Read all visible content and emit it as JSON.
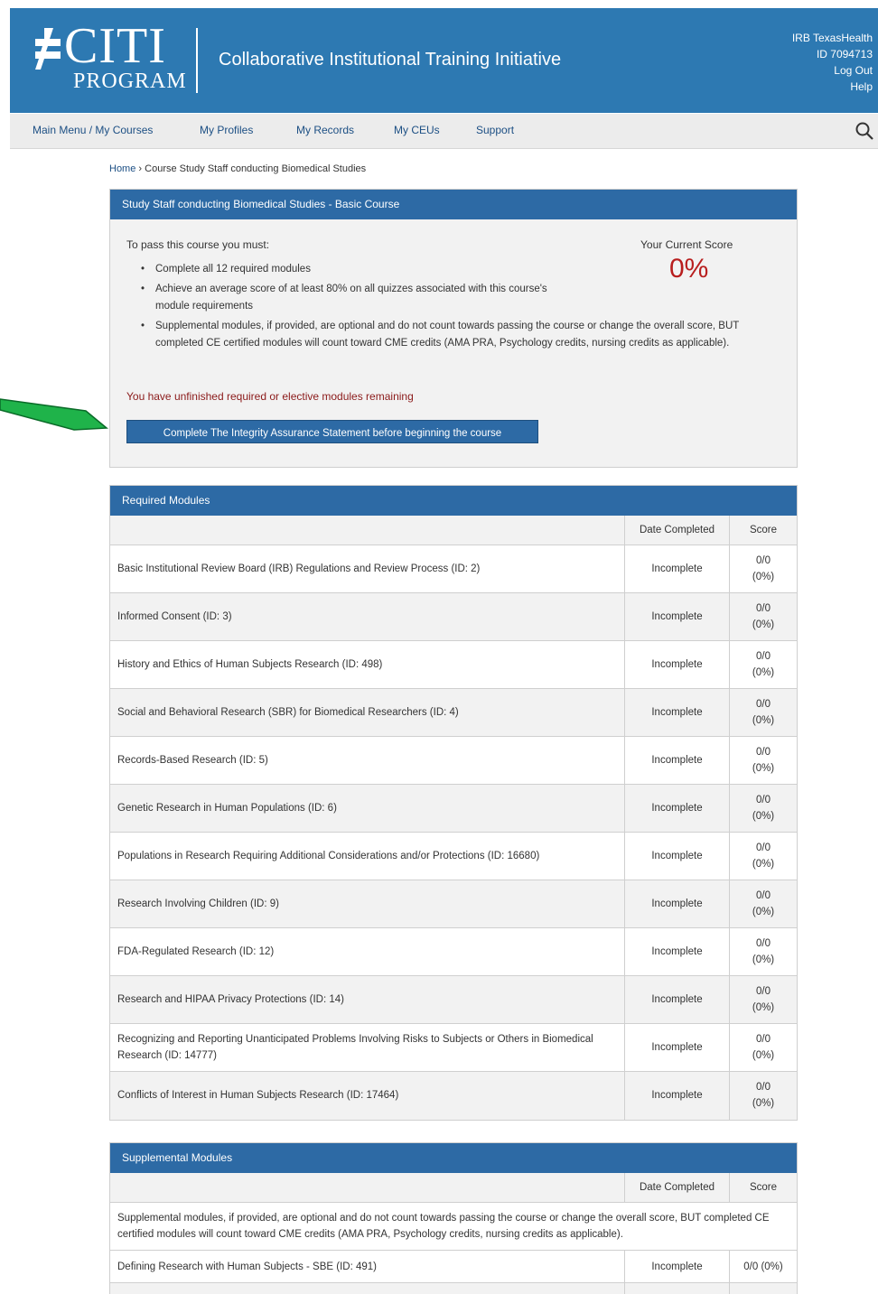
{
  "header": {
    "logo_main": "CITI",
    "logo_sub": "PROGRAM",
    "title": "Collaborative Institutional Training Initiative",
    "user_org": "IRB TexasHealth",
    "user_id": "ID 7094713",
    "logout": "Log Out",
    "help": "Help"
  },
  "nav": {
    "items": [
      "Main Menu / My Courses",
      "My Profiles",
      "My Records",
      "My CEUs",
      "Support"
    ]
  },
  "breadcrumb": {
    "home": "Home",
    "separator": "›",
    "current": "Course Study Staff conducting Biomedical Studies"
  },
  "course": {
    "title": "Study Staff conducting Biomedical Studies - Basic Course",
    "intro": "To pass this course you must:",
    "requirements": [
      "Complete all 12 required modules",
      "Achieve an average score of at least 80% on all quizzes associated with this course's module requirements",
      "Supplemental modules, if provided, are optional and do not count towards passing the course or change the overall score, BUT completed CE certified modules will count toward CME credits (AMA PRA, Psychology credits, nursing credits as applicable)."
    ],
    "score_label": "Your Current Score",
    "score_value": "0%",
    "unfinished_note": "You have unfinished required or elective modules remaining",
    "button_label": "Complete The Integrity Assurance Statement before beginning the course"
  },
  "required": {
    "title": "Required Modules",
    "col_date": "Date Completed",
    "col_score": "Score",
    "rows": [
      {
        "name": "Basic Institutional Review Board (IRB) Regulations and Review Process (ID: 2)",
        "date": "Incomplete",
        "score1": "0/0",
        "score2": "(0%)"
      },
      {
        "name": "Informed Consent (ID: 3)",
        "date": "Incomplete",
        "score1": "0/0",
        "score2": "(0%)"
      },
      {
        "name": "History and Ethics of Human Subjects Research (ID: 498)",
        "date": "Incomplete",
        "score1": "0/0",
        "score2": "(0%)"
      },
      {
        "name": "Social and Behavioral Research (SBR) for Biomedical Researchers (ID: 4)",
        "date": "Incomplete",
        "score1": "0/0",
        "score2": "(0%)"
      },
      {
        "name": "Records-Based Research (ID: 5)",
        "date": "Incomplete",
        "score1": "0/0",
        "score2": "(0%)"
      },
      {
        "name": "Genetic Research in Human Populations (ID: 6)",
        "date": "Incomplete",
        "score1": "0/0",
        "score2": "(0%)"
      },
      {
        "name": "Populations in Research Requiring Additional Considerations and/or Protections (ID: 16680)",
        "date": "Incomplete",
        "score1": "0/0",
        "score2": "(0%)"
      },
      {
        "name": "Research Involving Children (ID: 9)",
        "date": "Incomplete",
        "score1": "0/0",
        "score2": "(0%)"
      },
      {
        "name": "FDA-Regulated Research (ID: 12)",
        "date": "Incomplete",
        "score1": "0/0",
        "score2": "(0%)"
      },
      {
        "name": "Research and HIPAA Privacy Protections (ID: 14)",
        "date": "Incomplete",
        "score1": "0/0",
        "score2": "(0%)"
      },
      {
        "name": "Recognizing and Reporting Unanticipated Problems Involving Risks to Subjects or Others in Biomedical Research (ID: 14777)",
        "date": "Incomplete",
        "score1": "0/0",
        "score2": "(0%)"
      },
      {
        "name": "Conflicts of Interest in Human Subjects Research (ID: 17464)",
        "date": "Incomplete",
        "score1": "0/0",
        "score2": "(0%)"
      }
    ]
  },
  "supplemental": {
    "title": "Supplemental Modules",
    "col_date": "Date Completed",
    "col_score": "Score",
    "note": "Supplemental modules, if provided, are optional and do not count towards passing the course or change the overall score, BUT completed CE certified modules will count toward CME credits (AMA PRA, Psychology credits, nursing credits as applicable).",
    "rows": [
      {
        "name": "Defining Research with Human Subjects - SBE (ID: 491)",
        "date": "Incomplete",
        "score": "0/0 (0%)"
      }
    ]
  },
  "colors": {
    "header_blue": "#2d79b2",
    "panel_blue": "#2d6aa5",
    "score_red": "#b81e1e",
    "arrow_green": "#1fb34a"
  },
  "icons": {
    "search": "search-icon",
    "logo_mark": "citi-logo-mark-icon",
    "arrow": "annotation-arrow"
  }
}
